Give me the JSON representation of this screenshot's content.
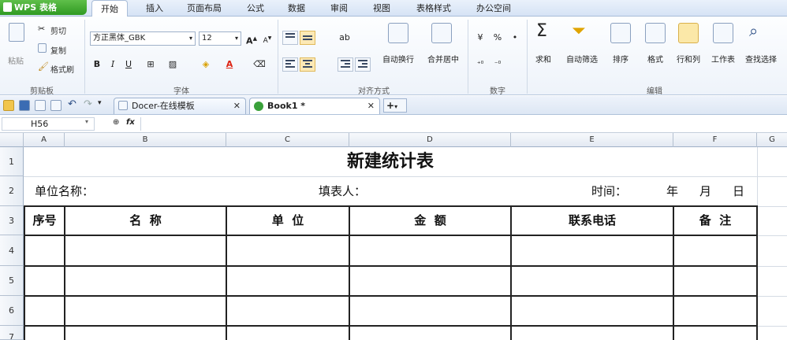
{
  "app": {
    "name": "WPS 表格"
  },
  "menu": {
    "tabs": [
      "开始",
      "插入",
      "页面布局",
      "公式",
      "数据",
      "审阅",
      "视图",
      "表格样式",
      "办公空间"
    ],
    "active_tab": "开始"
  },
  "ribbon": {
    "clipboard": {
      "paste": "粘贴",
      "cut": "剪切",
      "copy": "复制",
      "format_painter": "格式刷",
      "group": "剪贴板"
    },
    "font": {
      "name": "方正黑体_GBK",
      "size": "12",
      "bold": "B",
      "italic": "I",
      "underline": "U",
      "group": "字体"
    },
    "alignment": {
      "merge_center": "合并居中",
      "wrap_text": "自动换行",
      "group": "对齐方式"
    },
    "number": {
      "percent": "%",
      "group": "数字"
    },
    "editing": {
      "sum": "求和",
      "autofilter": "自动筛选",
      "sort": "排序",
      "format": "格式",
      "rows_cols": "行和列",
      "worksheet": "工作表",
      "find_select": "查找选择",
      "group": "编辑"
    }
  },
  "doc_tabs": [
    {
      "label": "Docer-在线模板",
      "active": false
    },
    {
      "label": "Book1 *",
      "active": true
    }
  ],
  "formula_bar": {
    "name_box": "H56",
    "fx": "fx",
    "formula": ""
  },
  "columns": [
    "A",
    "B",
    "C",
    "D",
    "E",
    "F",
    "G"
  ],
  "rows": [
    "1",
    "2",
    "3",
    "4",
    "5",
    "6",
    "7"
  ],
  "sheet": {
    "title": "新建统计表",
    "row2": {
      "unit": "单位名称：",
      "filler": "填表人：",
      "time": "时间：",
      "year": "年",
      "month": "月",
      "day": "日"
    },
    "headers": [
      "序号",
      "名  称",
      "单  位",
      "金  额",
      "联系电话",
      "备  注"
    ]
  },
  "colors": {
    "accent": "#2f9a22",
    "ribbon_bg": "#eef3fa",
    "active_align": "#fce9b6"
  }
}
